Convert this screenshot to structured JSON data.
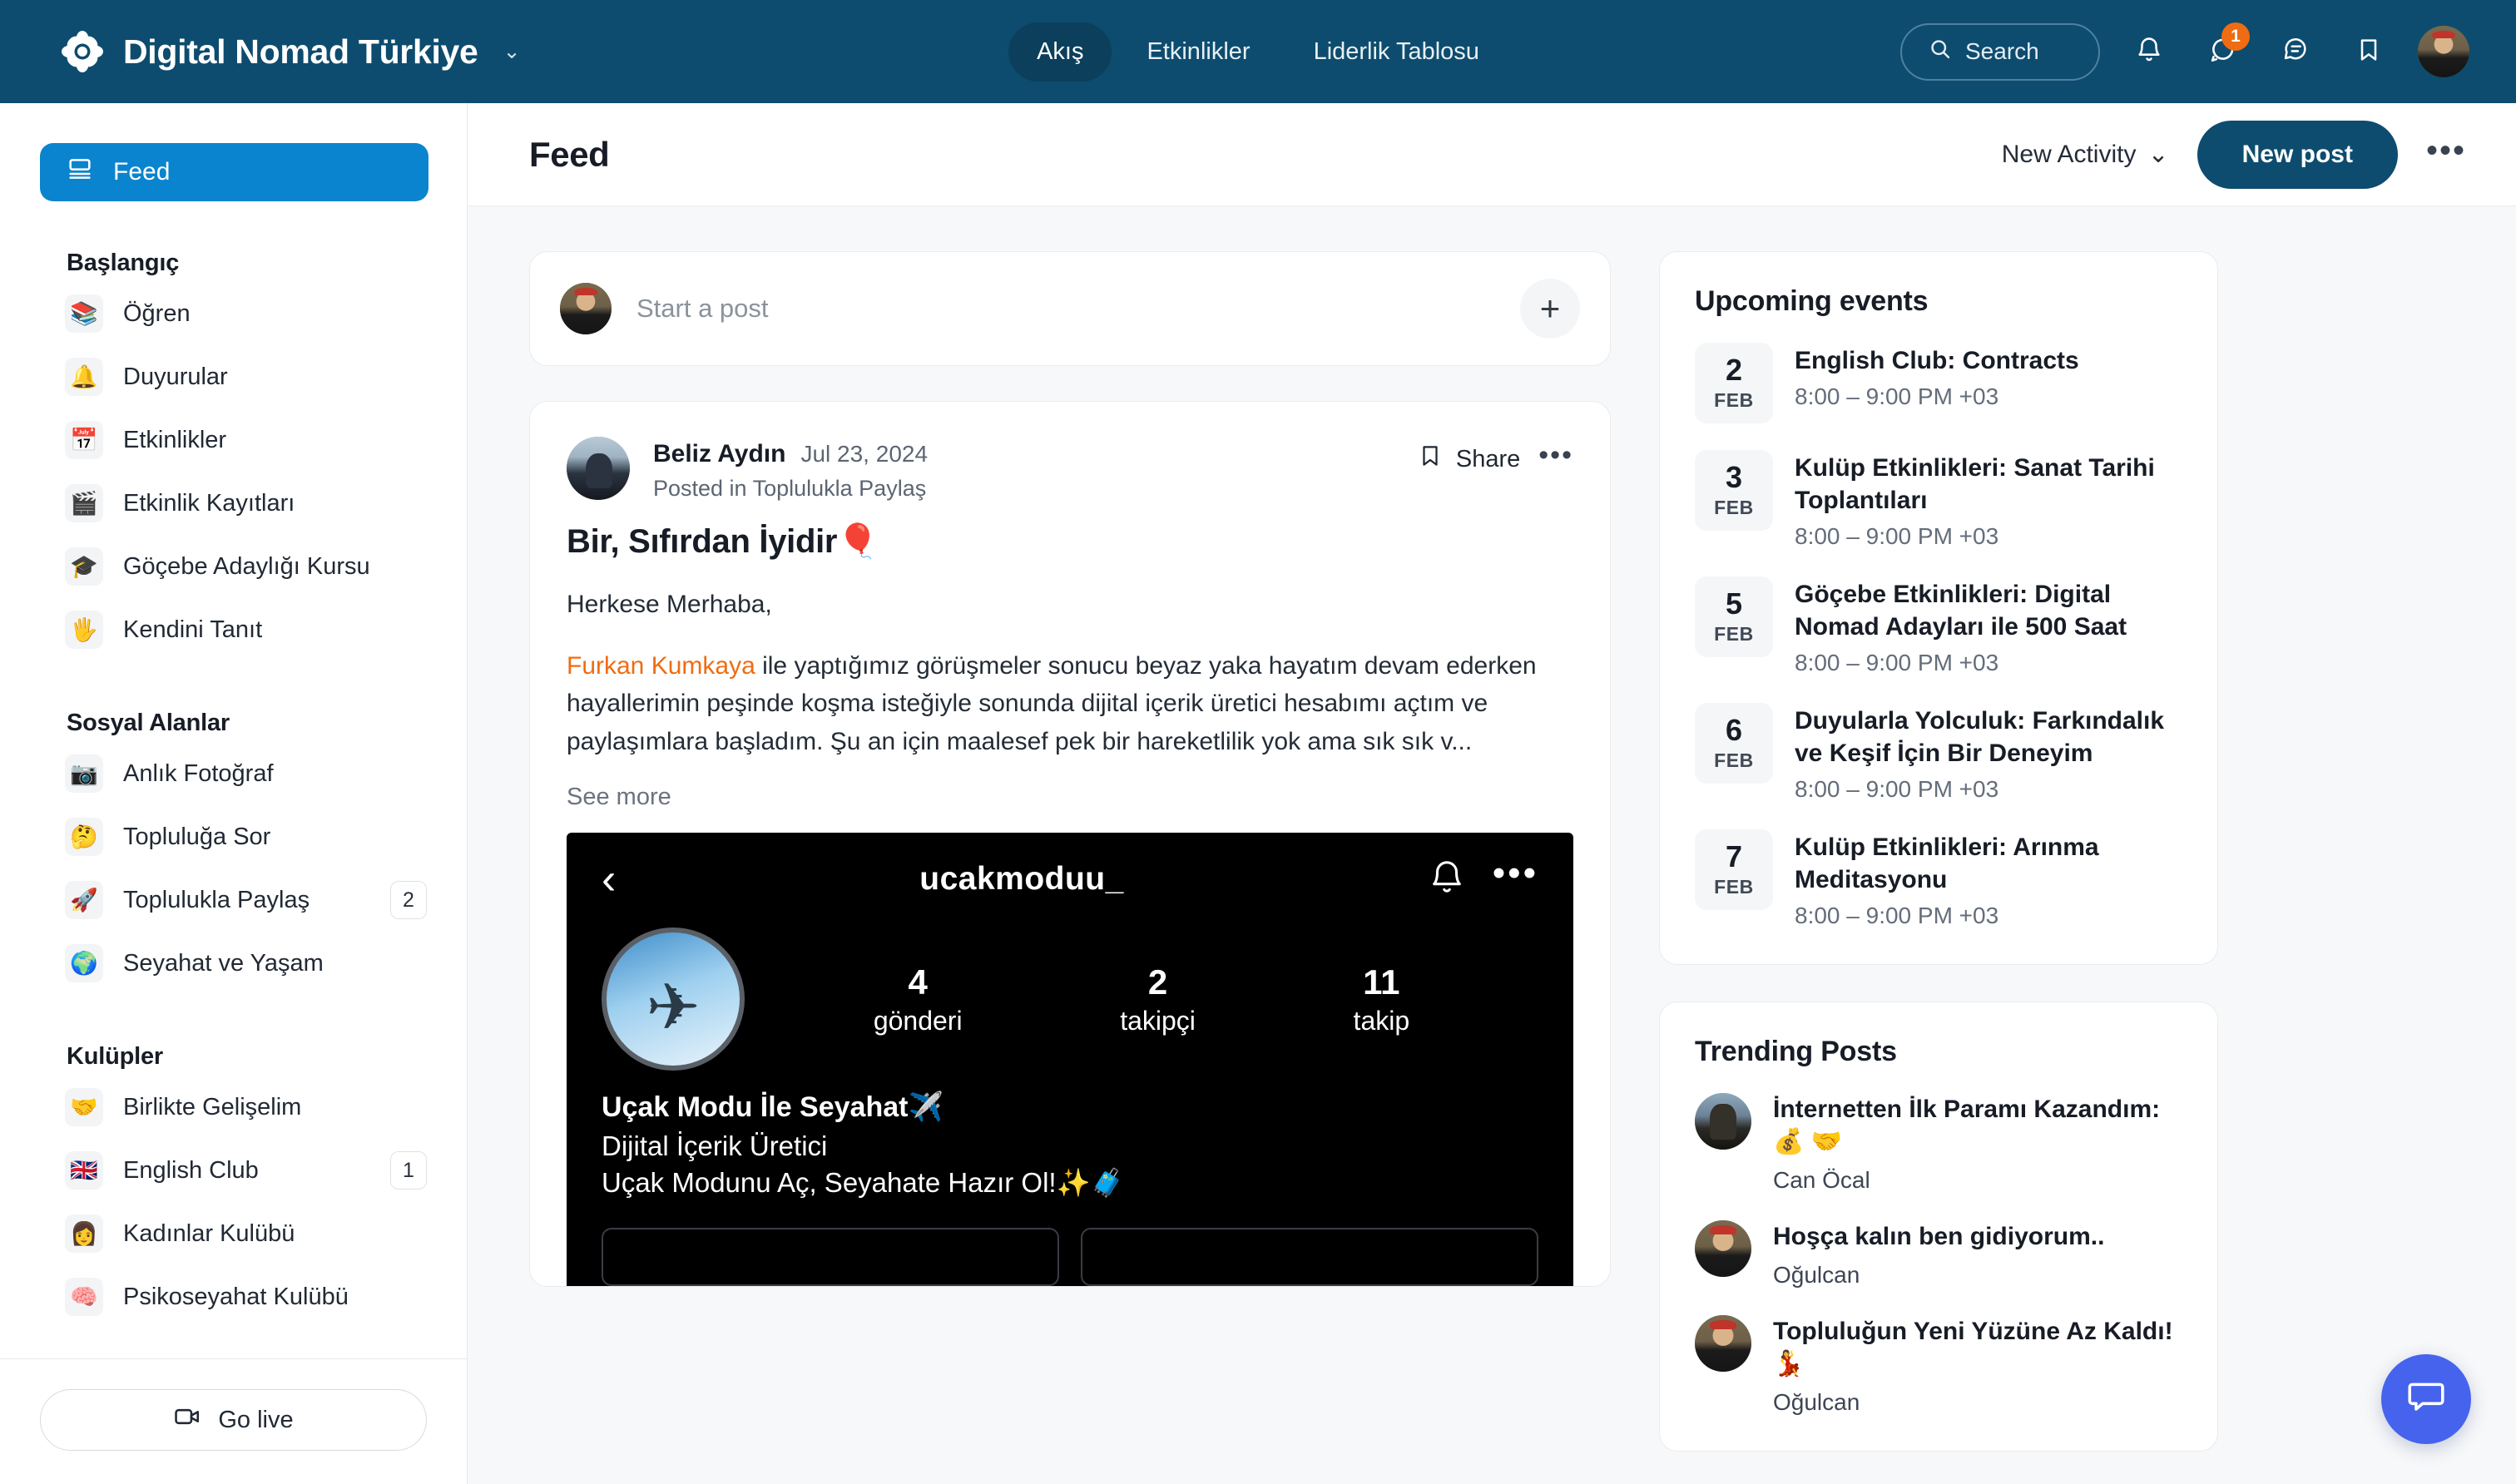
{
  "topnav": {
    "brand_title": "Digital Nomad Türkiye",
    "brand_caret": "⌄",
    "nav_items": [
      {
        "label": "Akış",
        "active": true
      },
      {
        "label": "Etkinlikler",
        "active": false
      },
      {
        "label": "Liderlik Tablosu",
        "active": false
      }
    ],
    "search_label": "Search",
    "notification_badge": "1",
    "icons": [
      "search-icon",
      "bell-icon",
      "messages-icon",
      "activity-icon",
      "bookmark-icon",
      "avatar"
    ]
  },
  "sidebar": {
    "feed_label": "Feed",
    "sections": [
      {
        "heading": "Başlangıç",
        "items": [
          {
            "emoji": "📚",
            "label": "Öğren",
            "count": ""
          },
          {
            "emoji": "🔔",
            "label": "Duyurular",
            "count": ""
          },
          {
            "emoji": "📅",
            "label": "Etkinlikler",
            "count": ""
          },
          {
            "emoji": "🎬",
            "label": "Etkinlik Kayıtları",
            "count": ""
          },
          {
            "emoji": "🎓",
            "label": "Göçebe Adaylığı Kursu",
            "count": ""
          },
          {
            "emoji": "🖐",
            "label": "Kendini Tanıt",
            "count": ""
          }
        ]
      },
      {
        "heading": "Sosyal Alanlar",
        "items": [
          {
            "emoji": "📷",
            "label": "Anlık Fotoğraf",
            "count": ""
          },
          {
            "emoji": "🤔",
            "label": "Topluluğa Sor",
            "count": ""
          },
          {
            "emoji": "🚀",
            "label": "Toplulukla Paylaş",
            "count": "2"
          },
          {
            "emoji": "🌍",
            "label": "Seyahat ve Yaşam",
            "count": ""
          }
        ]
      },
      {
        "heading": "Kulüpler",
        "items": [
          {
            "emoji": "🤝",
            "label": "Birlikte Gelişelim",
            "count": ""
          },
          {
            "emoji": "🇬🇧",
            "label": "English Club",
            "count": "1"
          },
          {
            "emoji": "👩",
            "label": "Kadınlar Kulübü",
            "count": ""
          },
          {
            "emoji": "🧠",
            "label": "Psikoseyahat Kulübü",
            "count": ""
          }
        ]
      }
    ],
    "go_live_label": "Go live"
  },
  "page": {
    "title": "Feed",
    "activity_filter": "New Activity",
    "activity_caret": "⌄",
    "new_post_label": "New post",
    "overflow_label": "•••"
  },
  "composer": {
    "placeholder": "Start a post",
    "add_label": "+"
  },
  "post": {
    "author": "Beliz Aydın",
    "date": "Jul 23, 2024",
    "posted_in": "Posted in Toplulukla Paylaş",
    "share_label": "Share",
    "overflow_label": "•••",
    "title": "Bir, Sıfırdan İyidir🎈",
    "greeting": "Herkese Merhaba,",
    "mention": "Furkan Kumkaya",
    "body": " ile yaptığımız görüşmeler sonucu beyaz yaka hayatım devam ederken hayallerimin peşinde koşma isteğiyle sonunda dijital içerik üretici hesabımı açtım ve paylaşımlara başladım. Şu an için maalesef pek bir hareketlilik yok ama sık sık v...",
    "see_more": "See more",
    "embed": {
      "username": "ucakmoduu_",
      "stats": [
        {
          "num": "4",
          "label": "gönderi"
        },
        {
          "num": "2",
          "label": "takipçi"
        },
        {
          "num": "11",
          "label": "takip"
        }
      ],
      "bio_name": "Uçak Modu İle Seyahat✈️",
      "bio_line1": "Dijital İçerik Üretici",
      "bio_line2": "Uçak Modunu Aç, Seyahate Hazır Ol!✨🧳"
    }
  },
  "upcoming_events": {
    "title": "Upcoming events",
    "items": [
      {
        "day": "2",
        "month": "FEB",
        "name": "English Club: Contracts",
        "time": "8:00 – 9:00 PM +03"
      },
      {
        "day": "3",
        "month": "FEB",
        "name": "Kulüp Etkinlikleri: Sanat Tarihi Toplantıları",
        "time": "8:00 – 9:00 PM +03"
      },
      {
        "day": "5",
        "month": "FEB",
        "name": "Göçebe Etkinlikleri: Digital Nomad Adayları ile 500 Saat",
        "time": "8:00 – 9:00 PM +03"
      },
      {
        "day": "6",
        "month": "FEB",
        "name": "Duyularla Yolculuk: Farkındalık ve Keşif İçin Bir Deneyim",
        "time": "8:00 – 9:00 PM +03"
      },
      {
        "day": "7",
        "month": "FEB",
        "name": "Kulüp Etkinlikleri: Arınma Meditasyonu",
        "time": "8:00 – 9:00 PM +03"
      }
    ]
  },
  "trending_posts": {
    "title": "Trending Posts",
    "items": [
      {
        "title": "İnternetten İlk Paramı Kazandım: 💰 🤝",
        "author": "Can Öcal"
      },
      {
        "title": "Hoşça kalın ben gidiyorum..",
        "author": "Oğulcan"
      },
      {
        "title": "Topluluğun Yeni Yüzüne Az Kaldı! 💃",
        "author": "Oğulcan"
      }
    ]
  },
  "colors": {
    "navbar": "#0d4c6e",
    "accent_blue": "#0a84ce",
    "mention_orange": "#ef6c12",
    "badge_orange": "#ef6c12",
    "chat_fab": "#4663ed"
  }
}
